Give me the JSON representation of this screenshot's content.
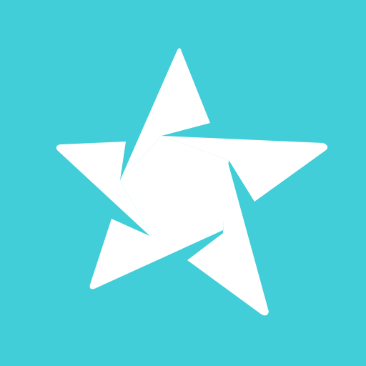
{
  "app_icon": {
    "icon_name": "folded-star-icon",
    "background_color": "#41ced8",
    "foreground_color": "#ffffff"
  }
}
